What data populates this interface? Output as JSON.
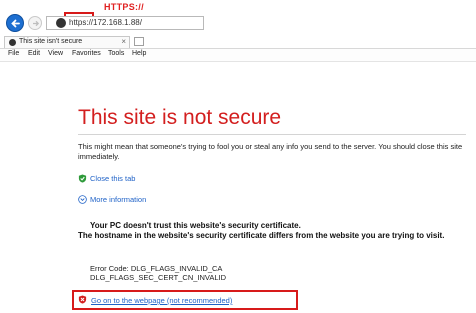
{
  "annotation": {
    "label": "HTTPS://"
  },
  "navbar": {
    "url_scheme": "https://",
    "url_rest": "172.168.1.88/"
  },
  "tab": {
    "title": "This site isn't secure",
    "close": "×"
  },
  "menu": [
    "File",
    "Edit",
    "View",
    "Favorites",
    "Tools",
    "Help"
  ],
  "content": {
    "heading": "This site is not secure",
    "description": "This might mean that someone's trying to fool you or steal any info you send to the server. You should close this site immediately.",
    "close_tab": "Close this tab",
    "more_info": "More information",
    "trust_line1": "Your PC doesn't trust this website's security certificate.",
    "trust_line2": "The hostname in the website's security certificate differs from the website you are trying to visit.",
    "error_code_1": "Error Code: DLG_FLAGS_INVALID_CA",
    "error_code_2": "DLG_FLAGS_SEC_CERT_CN_INVALID",
    "go_on": "Go on to the webpage (not recommended)"
  },
  "colors": {
    "heading": "#d31f1f",
    "link": "#1f62c7",
    "highlight_box": "#d71a1a"
  }
}
